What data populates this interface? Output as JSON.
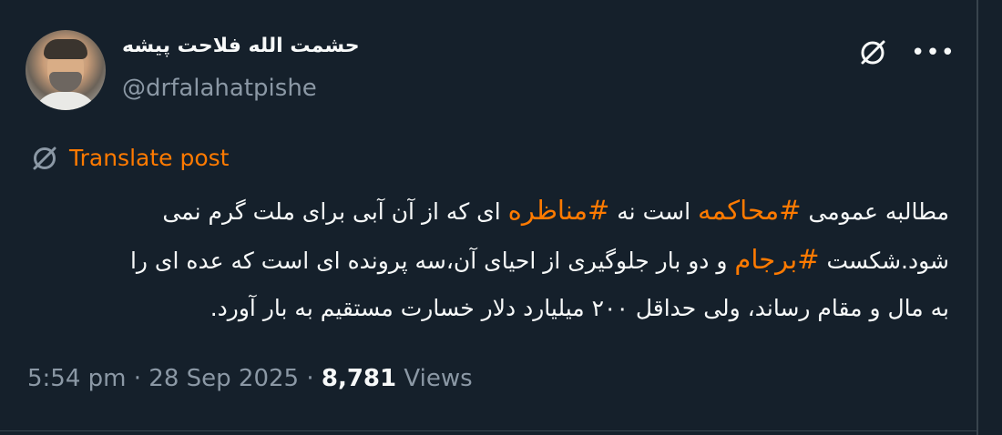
{
  "author": {
    "display_name": "حشمت الله فلاحت پیشه",
    "handle": "@drfalahatpishe"
  },
  "header_icons": {
    "grok": "grok-icon",
    "more": "more-horizontal-icon",
    "more_glyph": "•••"
  },
  "translate": {
    "icon": "translate-icon",
    "label": "Translate post"
  },
  "post": {
    "line1": {
      "a": "مطالبه عمومی ",
      "hashtag1": "#محاکمه",
      "b": " است نه ",
      "hashtag2": "#مناظره",
      "c": " ای که از آن آبی برای ملت گرم نمی"
    },
    "line2": {
      "a": "شود.شکست ",
      "hashtag3": "#برجام",
      "b": " و دو بار جلوگیری از احیای آن،سه پرونده ای است که عده ای را"
    },
    "line3": "به مال و مقام رساند، ولی حداقل ۲۰۰ میلیارد دلار خسارت مستقیم به بار آورد."
  },
  "meta": {
    "time": "5:54 pm",
    "sep1": " · ",
    "date": "28 Sep 2025",
    "sep2": " · ",
    "views_count": "8,781",
    "views_label": " Views"
  },
  "colors": {
    "background": "#15202b",
    "text": "#f7f9f9",
    "secondary": "#8b98a5",
    "accent": "#ff7a00",
    "border": "#38444d"
  }
}
